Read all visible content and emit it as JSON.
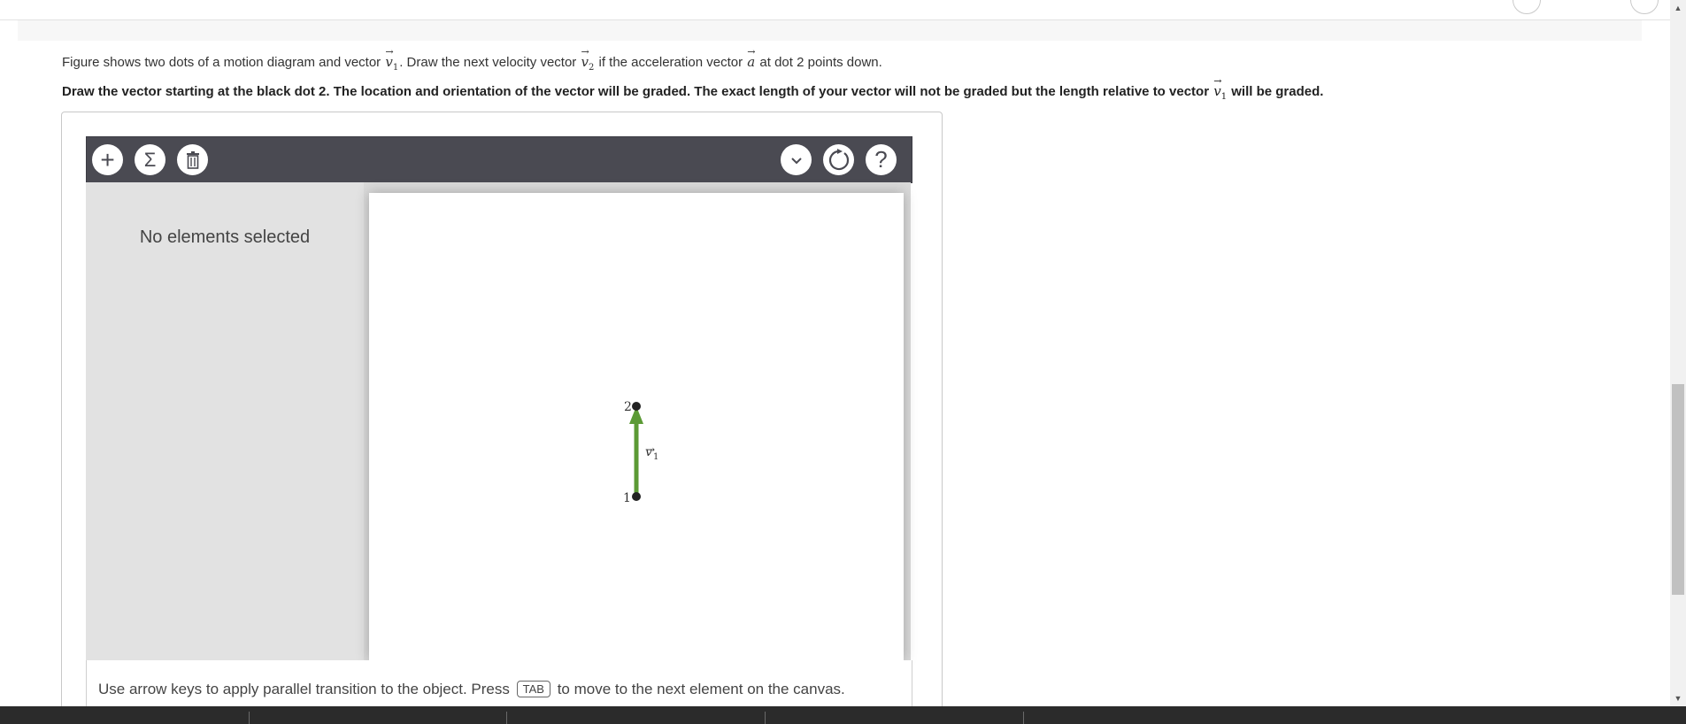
{
  "question": {
    "line1_a": "Figure shows two dots of a motion diagram and vector",
    "line1_v1": "v",
    "line1_v1_sub": "1",
    "line1_b": ". Draw the next velocity vector",
    "line1_v2": "v",
    "line1_v2_sub": "2",
    "line1_c": "if the acceleration vector",
    "line1_a_vec": "a",
    "line1_d": "at dot 2 points down.",
    "line2_a": "Draw the vector starting at the black dot 2. The location and orientation of the vector will be graded. The exact length of your vector will not be graded but the length relative to vector",
    "line2_v": "v",
    "line2_v_sub": "1",
    "line2_b": "will be graded."
  },
  "toolbar": {
    "add": "+",
    "sum": "Σ",
    "help": "?"
  },
  "panel": {
    "message": "No elements selected"
  },
  "diagram": {
    "dot1_label": "1",
    "dot2_label": "2",
    "vector_label": "v",
    "vector_label_sub": "1",
    "vector_color": "#5b9a35"
  },
  "footer": {
    "hint_before": "Use arrow keys to apply parallel transition to the object. Press",
    "key": "TAB",
    "hint_after": "to move to the next element on the canvas."
  }
}
